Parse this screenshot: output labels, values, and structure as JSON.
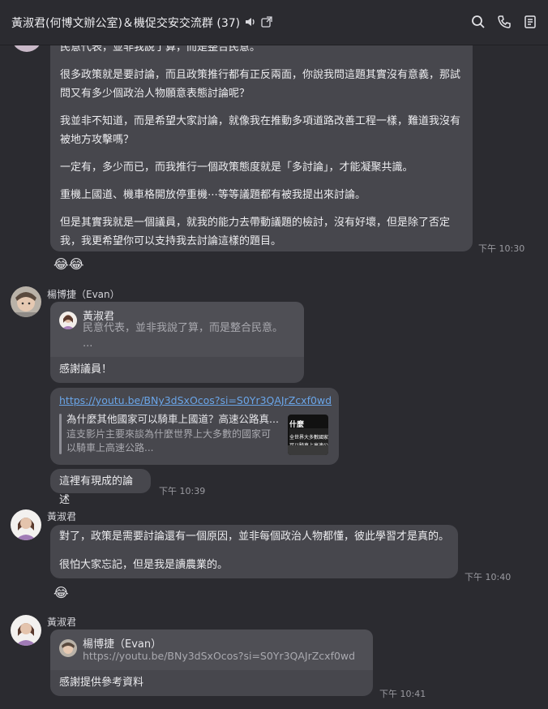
{
  "header": {
    "title": "黃淑君(何博文辦公室)＆機促交安交流群",
    "member_count": "(37)",
    "icons": [
      "speaker-icon",
      "popout-icon",
      "search-icon",
      "phone-icon",
      "notes-icon"
    ]
  },
  "messages": {
    "first": {
      "paragraphs": [
        "民意代表，並非我說了算，而是整合民意。",
        "很多政策就是要討論，而且政策推行都有正反兩面，你說我問這題其實沒有意義，那試問又有多少個政治人物願意表態討論呢？",
        "我並非不知道，而是希望大家討論，就像我在推動多項道路改善工程一樣，難道我沒有被地方攻擊嗎？",
        "一定有，多少而已，而我推行一個政策態度就是「多討論」，才能凝聚共識。",
        "重機上國道、機車格開放停重機⋯等等議題都有被我提出來討論。",
        "但是其實我就是一個議員，就我的能力去帶動議題的檢討，沒有好壞，但是除了否定我，我更希望你可以支持我去討論這樣的題目。"
      ],
      "time": "下午 10:30",
      "reaction": "😂😂"
    },
    "evan": {
      "sender": "楊博捷（Evan）",
      "reply": {
        "name": "黃淑君",
        "text": "民意代表，並非我說了算，而是整合民意。",
        "more": "..."
      },
      "text": "感謝議員！",
      "link": {
        "url": "https://youtu.be/BNy3dSxOcos?si=S0Yr3QAJrZcxf0wd",
        "title": "為什麼其他國家可以騎車上國道？高速公路真...",
        "desc1": "這支影片主要來談為什麼世界上大多數的國家可",
        "desc2": "以騎車上高速公路..."
      },
      "thumb_text_1": "什麼",
      "thumb_text_2": "全世界大多數國家",
      "thumb_text_3": "可以騎車上高速公路",
      "text2": "這裡有現成的論述",
      "time": "下午 10:39"
    },
    "huang1": {
      "sender": "黃淑君",
      "paragraphs": [
        "對了，政策是需要討論還有一個原因，並非每個政治人物都懂，彼此學習才是真的。",
        "很怕大家忘記，但是我是讀農業的。"
      ],
      "time": "下午 10:40",
      "reaction": "😂"
    },
    "huang2": {
      "sender": "黃淑君",
      "reply": {
        "name": "楊博捷（Evan）",
        "text": "https://youtu.be/BNy3dSxOcos?si=S0Yr3QAJrZcxf0wd"
      },
      "text": "感謝提供參考資料",
      "time": "下午 10:41"
    }
  }
}
